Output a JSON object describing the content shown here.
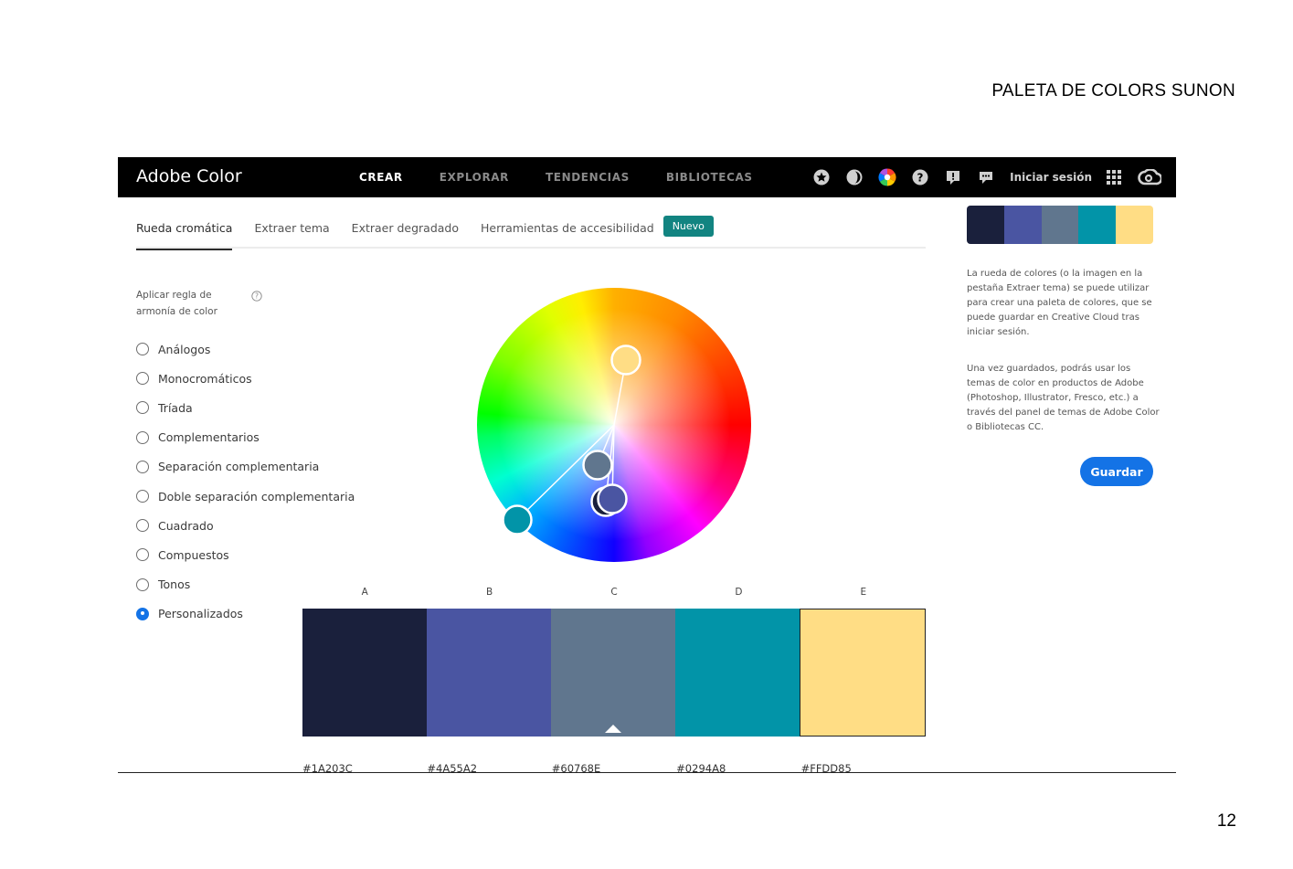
{
  "document": {
    "title": "PALETA DE COLORS SUNON",
    "page_number": "12"
  },
  "app": {
    "brand": "Adobe Color",
    "nav": [
      {
        "label": "CREAR",
        "active": true
      },
      {
        "label": "EXPLORAR",
        "active": false
      },
      {
        "label": "TENDENCIAS",
        "active": false
      },
      {
        "label": "BIBLIOTECAS",
        "active": false
      }
    ],
    "toolbar_icons": [
      "star-icon",
      "contrast-icon",
      "color-wheel-icon",
      "help-icon",
      "feedback-icon",
      "chat-icon"
    ],
    "signin_label": "Iniciar sesión"
  },
  "tabs": [
    {
      "label": "Rueda cromática",
      "active": true
    },
    {
      "label": "Extraer tema",
      "active": false
    },
    {
      "label": "Extraer degradado",
      "active": false
    },
    {
      "label": "Herramientas de accesibilidad",
      "active": false
    }
  ],
  "new_badge": "Nuevo",
  "harmony": {
    "heading_line1": "Aplicar regla de",
    "heading_line2": "armonía de color",
    "rules": [
      {
        "label": "Análogos",
        "checked": false
      },
      {
        "label": "Monocromáticos",
        "checked": false
      },
      {
        "label": "Tríada",
        "checked": false
      },
      {
        "label": "Complementarios",
        "checked": false
      },
      {
        "label": "Separación complementaria",
        "checked": false
      },
      {
        "label": "Doble separación complementaria",
        "checked": false
      },
      {
        "label": "Cuadrado",
        "checked": false
      },
      {
        "label": "Compuestos",
        "checked": false
      },
      {
        "label": "Tonos",
        "checked": false
      },
      {
        "label": "Personalizados",
        "checked": true
      }
    ]
  },
  "swatches": [
    {
      "letter": "A",
      "hex": "#1A203C",
      "color": "#1A203C"
    },
    {
      "letter": "B",
      "hex": "#4A55A2",
      "color": "#4A55A2"
    },
    {
      "letter": "C",
      "hex": "#60768E",
      "color": "#60768E",
      "selected": true
    },
    {
      "letter": "D",
      "hex": "#0294A8",
      "color": "#0294A8"
    },
    {
      "letter": "E",
      "hex": "#FFDD85",
      "color": "#FFDD85"
    }
  ],
  "info": {
    "paragraph1": "La rueda de colores (o la imagen en la pestaña Extraer tema) se puede utilizar para crear una paleta de colores, que se puede guardar en Creative Cloud tras iniciar sesión.",
    "paragraph2": "Una vez guardados, podrás usar los temas de color en productos de Adobe (Photoshop, Illustrator, Fresco, etc.) a través del panel de temas de Adobe Color o Bibliotecas CC."
  },
  "save_label": "Guardar",
  "colors": {
    "accent": "#1473e6",
    "badge": "#128481"
  }
}
